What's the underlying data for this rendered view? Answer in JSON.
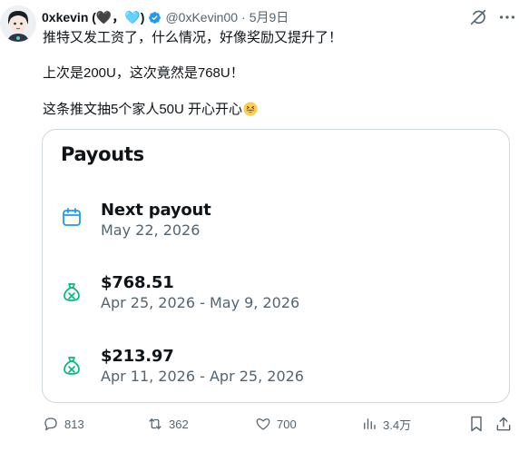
{
  "tweet": {
    "author_name": "0xkevin (🖤，🩵)",
    "handle": "@0xKevin00",
    "separator": "·",
    "date": "5月9日",
    "lines": [
      "推特又发工资了，什么情况，好像奖励又提升了！",
      "上次是200U，这次竟然是768U！",
      "这条推文抽5个家人50U 开心开心"
    ]
  },
  "payouts_card": {
    "title": "Payouts",
    "next_payout": {
      "label": "Next payout",
      "date": "May 22, 2026"
    },
    "entries": [
      {
        "amount": "$768.51",
        "period": "Apr 25, 2026 - May 9, 2026"
      },
      {
        "amount": "$213.97",
        "period": "Apr 11, 2026 - Apr 25, 2026"
      }
    ]
  },
  "actions": {
    "replies": "813",
    "reposts": "362",
    "likes": "700",
    "views": "3.4万"
  },
  "colors": {
    "verified_blue": "#1d9bf0",
    "calendar_blue": "#1d9bf0",
    "moneybag_green": "#00ba7c",
    "muted_text": "#536471"
  },
  "icons": [
    "avatar",
    "verified-badge-icon",
    "grok-icon",
    "more-icon",
    "calendar-icon",
    "money-bag-icon",
    "reply-icon",
    "repost-icon",
    "like-icon",
    "views-icon",
    "bookmark-icon",
    "share-icon",
    "grin-emoji-icon"
  ]
}
